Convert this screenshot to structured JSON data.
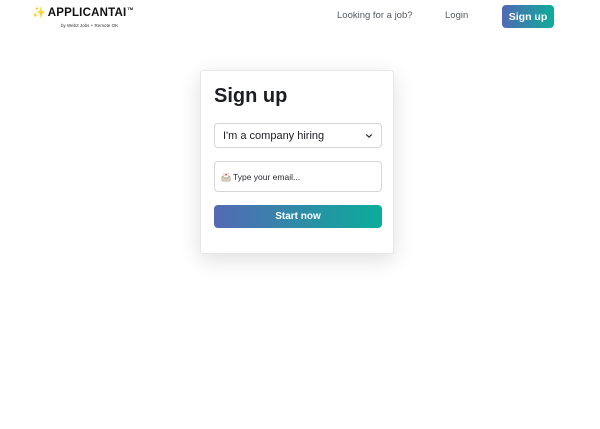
{
  "header": {
    "logo": {
      "sparkle_icon": "sparkles-icon",
      "name": "APPLICANTAI",
      "tm": "TM",
      "tagline": "by Web3 Jobs + Remote OK"
    },
    "nav": {
      "job_link": "Looking for a job?",
      "login_link": "Login",
      "signup_button": "Sign up"
    }
  },
  "signup_card": {
    "title": "Sign up",
    "role_select": {
      "selected": "I'm a company hiring",
      "icon": "chevron-down-icon"
    },
    "email_field": {
      "icon": "envelope-icon",
      "placeholder": "Type your email..."
    },
    "submit_button": "Start now"
  },
  "colors": {
    "gradient_start": "#5169b4",
    "gradient_end": "#0dad99",
    "text_primary": "#1c1e22",
    "text_nav": "#555a61"
  }
}
